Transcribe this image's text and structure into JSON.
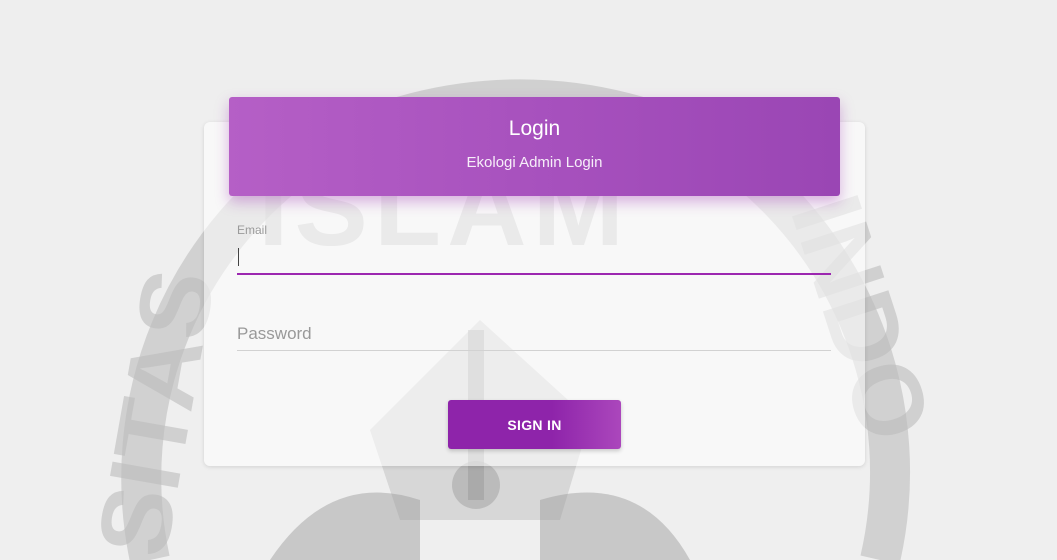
{
  "login_card": {
    "title": "Login",
    "subtitle": "Ekologi Admin Login",
    "accent_color": "#9c27b0"
  },
  "form": {
    "email_label": "Email",
    "email_value": "",
    "password_placeholder": "Password",
    "password_value": "",
    "signin_label": "SIGN IN"
  },
  "watermark": {
    "text_top": "ISLAM",
    "text_left": "SITAS",
    "text_right": "INDO"
  }
}
